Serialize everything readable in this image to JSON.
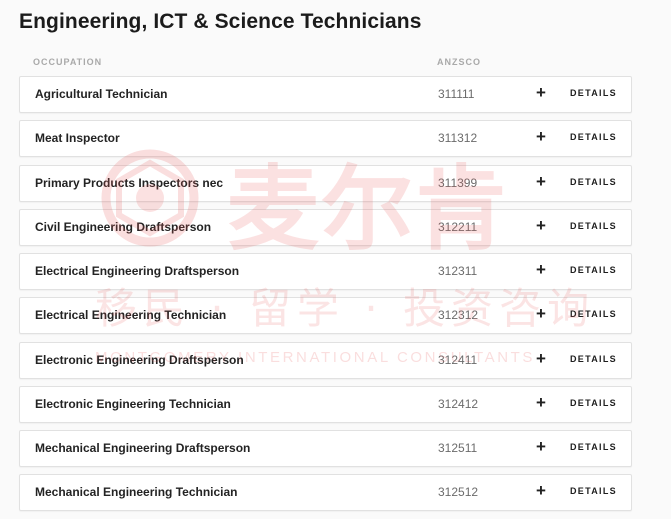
{
  "page": {
    "title": "Engineering, ICT & Science Technicians"
  },
  "table": {
    "headers": {
      "occupation": "OCCUPATION",
      "anzsco": "ANZSCO"
    },
    "expand_symbol": "+",
    "details_label": "DETAILS",
    "rows": [
      {
        "occupation": "Agricultural Technician",
        "anzsco": "311111"
      },
      {
        "occupation": "Meat Inspector",
        "anzsco": "311312"
      },
      {
        "occupation": "Primary Products Inspectors nec",
        "anzsco": "311399"
      },
      {
        "occupation": "Civil Engineering Draftsperson",
        "anzsco": "312211"
      },
      {
        "occupation": "Electrical Engineering Draftsperson",
        "anzsco": "312311"
      },
      {
        "occupation": "Electrical Engineering Technician",
        "anzsco": "312312"
      },
      {
        "occupation": "Electronic Engineering Draftsperson",
        "anzsco": "312411"
      },
      {
        "occupation": "Electronic Engineering Technician",
        "anzsco": "312412"
      },
      {
        "occupation": "Mechanical Engineering Draftsperson",
        "anzsco": "312511"
      },
      {
        "occupation": "Mechanical Engineering Technician",
        "anzsco": "312512"
      }
    ]
  },
  "watermark": {
    "brand": "麦尔肯",
    "subtitle": "移民 · 留学 · 投资咨询",
    "english": "MONTGOMERY INTERNATIONAL CONSULTANTS",
    "color": "#e85a5a"
  }
}
